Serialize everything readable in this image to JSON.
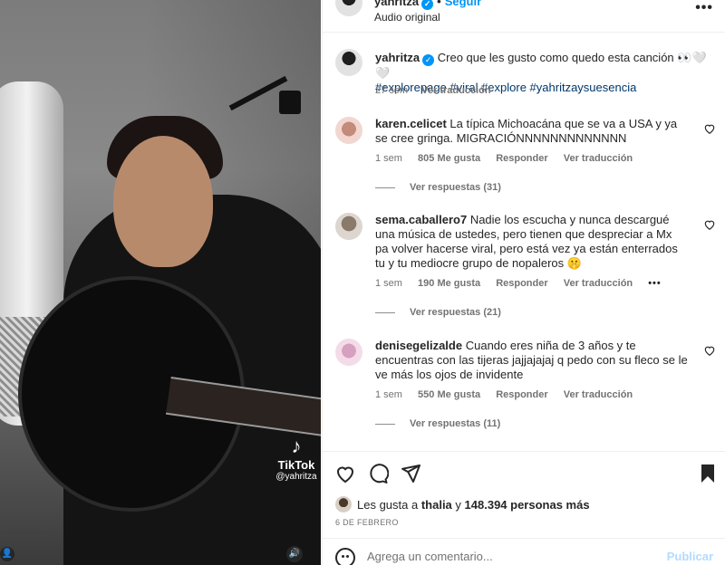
{
  "media": {
    "watermark_brand": "TikTok",
    "watermark_user": "@yahritza",
    "icons": [
      "tiktok-logo-icon",
      "user-tag-icon",
      "sound-icon"
    ]
  },
  "header": {
    "username": "yahritza",
    "separator": "•",
    "follow_label": "Seguir",
    "audio_label": "Audio original",
    "more_label": "•••"
  },
  "caption": {
    "username": "yahritza",
    "text": "Creo que les gusto como quedo esta canción 👀🤍🤍",
    "hashtags": "#explorepage #viral #explore #yahritzaysuesencia",
    "time": "27 sem",
    "translate": "Ver traducción"
  },
  "comments": [
    {
      "username": "karen.celicet",
      "text": "La típica Michoacána que se va a USA y ya se cree gringa. MIGRACIÓNNNNNNNNNNNNN",
      "time": "1 sem",
      "likes": "805 Me gusta",
      "reply": "Responder",
      "translate": "Ver traducción",
      "replies": "Ver respuestas (31)"
    },
    {
      "username": "sema.caballero7",
      "text": "Nadie los escucha y nunca descargué una música de ustedes, pero tienen que despreciar a Mx pa volver hacerse viral, pero está vez ya están enterrados tu y tu mediocre grupo de nopaleros 🤫",
      "time": "1 sem",
      "likes": "190 Me gusta",
      "reply": "Responder",
      "translate": "Ver traducción",
      "more": "•••",
      "replies": "Ver respuestas (21)"
    },
    {
      "username": "denisegelizalde",
      "text": "Cuando eres niña de 3 años y te encuentras con las tijeras jajjajajaj q pedo con su fleco se le ve más los ojos de invidente",
      "time": "1 sem",
      "likes": "550 Me gusta",
      "reply": "Responder",
      "translate": "Ver traducción",
      "replies": "Ver respuestas (11)"
    }
  ],
  "likes": {
    "prefix": "Les gusta a ",
    "user": "thalia",
    "middle": " y ",
    "count": "148.394 personas más"
  },
  "date": "6 DE FEBRERO",
  "comment_box": {
    "placeholder": "Agrega un comentario...",
    "publish_label": "Publicar"
  },
  "colors": {
    "accent": "#0095f6",
    "hashtag": "#00376b",
    "muted": "#737373",
    "publish_disabled": "#b3dbff"
  }
}
